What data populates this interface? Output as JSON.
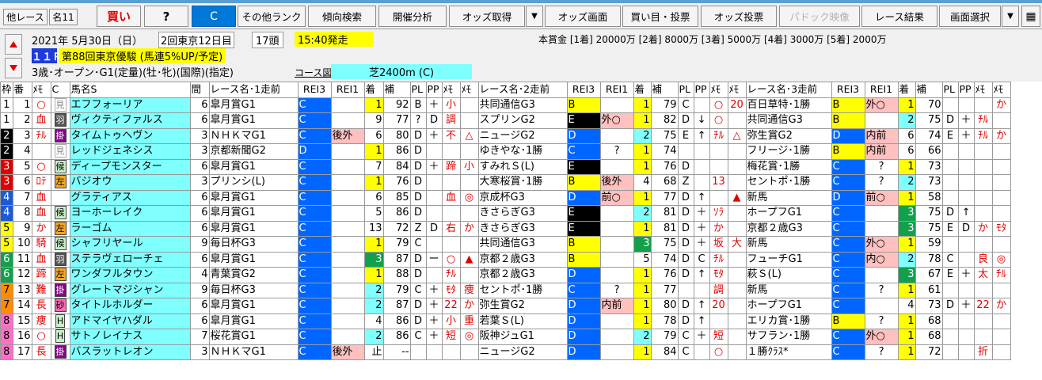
{
  "toolbar": {
    "other_race": "他レース",
    "meisho": "名11",
    "buy": "買い",
    "question": "?",
    "c": "C",
    "other_rank": "その他ランク",
    "trend_search": "傾向検索",
    "venue_analysis": "開催分析",
    "odds_get": "オッズ取得",
    "odds_screen": "オッズ画面",
    "buy_vote": "買い目・投票",
    "odds_vote": "オッズ投票",
    "paddock": "パドック映像",
    "race_result": "レース結果",
    "screen_select": "画面選択"
  },
  "race": {
    "date": "2021年 5月30日（日）",
    "meeting": "2回東京12日目",
    "heads": "17頭",
    "start": "15:40発走",
    "prize": "本賞金 [1着] 20000万 [2着] 8000万 [3着] 5000万 [4着] 3000万 [5着] 2000万",
    "number": "１１Ｒ",
    "name": "第88回東京優駿 (馬連5%UP/予定)",
    "conditions": "3歳･オープン･G1(定量)(牡･牝)(国際)(指定)",
    "course_label": "コース図",
    "course": "芝2400m (C)"
  },
  "headers": {
    "waku": "枠",
    "ban": "番",
    "mo": "ﾒﾓ",
    "c": "C",
    "name": "馬名S",
    "interval": "間",
    "race1": "レース名･1走前",
    "race2": "レース名･2走前",
    "race3": "レース名･3走前",
    "red3": "REI3",
    "red1": "REI1",
    "chaku": "着",
    "ho": "補",
    "pl": "PL",
    "pp": "PP",
    "me": "ﾒﾓ",
    "mo2": "ﾒﾓ"
  },
  "rows": [
    {
      "waku": "1",
      "ban": "1",
      "mo": "○",
      "mk": "見",
      "mkc": "ken",
      "name": "エフフォーリア",
      "int": "6",
      "r1": "皐月賞G1",
      "r1a": "C",
      "r1b": "",
      "r1c": "1",
      "r1h": "92",
      "r1pl": "B",
      "r1pp": "＋",
      "r1m1": "小",
      "r1m2": "",
      "r2": "共同通信G3",
      "r2a": "B",
      "r2b": "",
      "r2c": "1",
      "r2h": "79",
      "r2pl": "C",
      "r2pp": "",
      "r2m1": "○",
      "r2m2": "20",
      "r3": "百日草特･1勝",
      "r3a": "B",
      "r3b": "外○",
      "r3c": "1",
      "r3h": "70",
      "r3pl": "",
      "r3pp": "",
      "r3m1": "",
      "r3m2": "か"
    },
    {
      "waku": "1",
      "ban": "2",
      "mo": "血",
      "mk": "羽",
      "mkc": "ma",
      "name": "ヴィクティファルス",
      "int": "6",
      "r1": "皐月賞G1",
      "r1a": "C",
      "r1b": "",
      "r1c": "9",
      "r1h": "77",
      "r1pl": "?",
      "r1pp": "D",
      "r1m1": "調",
      "r1m2": "",
      "r2": "スプリンG2",
      "r2a": "E",
      "r2b": "外○",
      "r2c": "1",
      "r2h": "82",
      "r2pl": "D",
      "r2pp": "↓",
      "r2m1": "○",
      "r2m2": "",
      "r3": "共同通信G3",
      "r3a": "B",
      "r3b": "",
      "r3c": "2",
      "r3h": "75",
      "r3pl": "D",
      "r3pp": "＋",
      "r3m1": "ﾁﾙ",
      "r3m2": ""
    },
    {
      "waku": "2",
      "ban": "3",
      "mo": "ﾁﾙ",
      "mk": "掛",
      "mkc": "kake",
      "name": "タイムトゥヘヴン",
      "int": "3",
      "r1": "ＮＨＫマG1",
      "r1a": "C",
      "r1b": "後外",
      "r1c": "6",
      "r1h": "80",
      "r1pl": "D",
      "r1pp": "＋",
      "r1m1": "不",
      "r1m2": "△",
      "r2": "ニュージG2",
      "r2a": "D",
      "r2b": "",
      "r2c": "2",
      "r2h": "75",
      "r2pl": "E",
      "r2pp": "↑",
      "r2m1": "ﾁﾙ",
      "r2m2": "△",
      "r3": "弥生賞G2",
      "r3a": "D",
      "r3b": "内前",
      "r3c": "6",
      "r3h": "74",
      "r3pl": "E",
      "r3pp": "＋",
      "r3m1": "ﾁﾙ",
      "r3m2": "か"
    },
    {
      "waku": "2",
      "ban": "4",
      "mo": "",
      "mk": "見",
      "mkc": "ken",
      "name": "レッドジェネシス",
      "int": "3",
      "r1": "京都新聞G2",
      "r1a": "D",
      "r1b": "",
      "r1c": "1",
      "r1h": "86",
      "r1pl": "D",
      "r1pp": "",
      "r1m1": "",
      "r1m2": "",
      "r2": "ゆきやな･1勝",
      "r2a": "C",
      "r2b": "?",
      "r2c": "1",
      "r2h": "74",
      "r2pl": "",
      "r2pp": "",
      "r2m1": "",
      "r2m2": "",
      "r3": "フリージ･1勝",
      "r3a": "B",
      "r3b": "内前",
      "r3c": "6",
      "r3h": "66",
      "r3pl": "",
      "r3pp": "",
      "r3m1": "",
      "r3m2": ""
    },
    {
      "waku": "3",
      "ban": "5",
      "mo": "○",
      "mk": "候",
      "mkc": "ko",
      "name": "ディープモンスター",
      "int": "6",
      "r1": "皐月賞G1",
      "r1a": "C",
      "r1b": "",
      "r1c": "7",
      "r1h": "84",
      "r1pl": "D",
      "r1pp": "＋",
      "r1m1": "蹄",
      "r1m2": "小",
      "r2": "すみれＳ(L)",
      "r2a": "E",
      "r2b": "",
      "r2c": "1",
      "r2h": "76",
      "r2pl": "D",
      "r2pp": "",
      "r2m1": "",
      "r2m2": "",
      "r3": "梅花賞･1勝",
      "r3a": "C",
      "r3b": "?",
      "r3c": "1",
      "r3h": "73",
      "r3pl": "",
      "r3pp": "",
      "r3m1": "",
      "r3m2": ""
    },
    {
      "waku": "3",
      "ban": "6",
      "mo": "ﾛﾃ",
      "mk": "左",
      "mkc": "sen",
      "name": "バジオウ",
      "int": "3",
      "r1": "プリンシ(L)",
      "r1a": "C",
      "r1b": "",
      "r1c": "1",
      "r1h": "76",
      "r1pl": "D",
      "r1pp": "",
      "r1m1": "",
      "r1m2": "",
      "r2": "大寒桜賞･1勝",
      "r2a": "B",
      "r2b": "後外",
      "r2c": "4",
      "r2h": "68",
      "r2pl": "Z",
      "r2pp": "",
      "r2m1": "13",
      "r2m2": "",
      "r3": "セントポ･1勝",
      "r3a": "C",
      "r3b": "?",
      "r3c": "2",
      "r3h": "73",
      "r3pl": "",
      "r3pp": "",
      "r3m1": "",
      "r3m2": ""
    },
    {
      "waku": "4",
      "ban": "7",
      "mo": "血",
      "mk": "",
      "mkc": "",
      "name": "グラティアス",
      "int": "6",
      "r1": "皐月賞G1",
      "r1a": "C",
      "r1b": "",
      "r1c": "6",
      "r1h": "85",
      "r1pl": "D",
      "r1pp": "",
      "r1m1": "血",
      "r1m2": "◎",
      "r2": "京成杯G3",
      "r2a": "D",
      "r2b": "前○",
      "r2c": "1",
      "r2h": "77",
      "r2pl": "D",
      "r2pp": "↑",
      "r2m1": "",
      "r2m2": "▲",
      "r3": "新馬",
      "r3a": "D",
      "r3b": "前○",
      "r3c": "1",
      "r3h": "58",
      "r3pl": "",
      "r3pp": "",
      "r3m1": "",
      "r3m2": ""
    },
    {
      "waku": "4",
      "ban": "8",
      "mo": "血",
      "mk": "候",
      "mkc": "ko",
      "name": "ヨーホーレイク",
      "int": "6",
      "r1": "皐月賞G1",
      "r1a": "C",
      "r1b": "",
      "r1c": "5",
      "r1h": "86",
      "r1pl": "D",
      "r1pp": "",
      "r1m1": "",
      "r1m2": "",
      "r2": "きさらぎG3",
      "r2a": "E",
      "r2b": "",
      "r2c": "2",
      "r2h": "81",
      "r2pl": "D",
      "r2pp": "＋",
      "r2m1": "ｿﾗ",
      "r2m2": "",
      "r3": "ホープフG1",
      "r3a": "C",
      "r3b": "",
      "r3c": "3",
      "r3h": "75",
      "r3pl": "D",
      "r3pp": "↑",
      "r3m1": "",
      "r3m2": ""
    },
    {
      "waku": "5",
      "ban": "9",
      "mo": "か",
      "mk": "左",
      "mkc": "sen",
      "name": "ラーゴム",
      "int": "6",
      "r1": "皐月賞G1",
      "r1a": "C",
      "r1b": "",
      "r1c": "13",
      "r1h": "72",
      "r1pl": "Z",
      "r1pp": "D",
      "r1m1": "右",
      "r1m2": "か",
      "r2": "きさらぎG3",
      "r2a": "E",
      "r2b": "",
      "r2c": "1",
      "r2h": "81",
      "r2pl": "D",
      "r2pp": "＋",
      "r2m1": "か",
      "r2m2": "",
      "r3": "京都２歳G3",
      "r3a": "C",
      "r3b": "",
      "r3c": "3",
      "r3h": "75",
      "r3pl": "E",
      "r3pp": "D",
      "r3m1": "か",
      "r3m2": "ﾓﾀ"
    },
    {
      "waku": "5",
      "ban": "10",
      "mo": "騎",
      "mk": "候",
      "mkc": "ko",
      "name": "シャフリヤール",
      "int": "9",
      "r1": "毎日杯G3",
      "r1a": "C",
      "r1b": "",
      "r1c": "1",
      "r1h": "79",
      "r1pl": "C",
      "r1pp": "",
      "r1m1": "",
      "r1m2": "",
      "r2": "共同通信G3",
      "r2a": "B",
      "r2b": "",
      "r2c": "3",
      "r2h": "75",
      "r2pl": "D",
      "r2pp": "＋",
      "r2m1": "坂",
      "r2m2": "大",
      "r3": "新馬",
      "r3a": "C",
      "r3b": "外○",
      "r3c": "1",
      "r3h": "59",
      "r3pl": "",
      "r3pp": "",
      "r3m1": "",
      "r3m2": ""
    },
    {
      "waku": "6",
      "ban": "11",
      "mo": "血",
      "mk": "羽",
      "mkc": "ma",
      "name": "ステラヴェローチェ",
      "int": "6",
      "r1": "皐月賞G1",
      "r1a": "C",
      "r1b": "",
      "r1c": "3",
      "r1h": "87",
      "r1pl": "D",
      "r1pp": "ー",
      "r1m1": "○",
      "r1m2": "▲",
      "r2": "京都２歳G3",
      "r2a": "B",
      "r2b": "",
      "r2c": "5",
      "r2h": "74",
      "r2pl": "D",
      "r2pp": "C",
      "r2m1": "ﾁﾙ",
      "r2m2": "",
      "r3": "フューチG1",
      "r3a": "C",
      "r3b": "内○",
      "r3c": "2",
      "r3h": "78",
      "r3pl": "C",
      "r3pp": "",
      "r3m1": "良",
      "r3m2": "◎"
    },
    {
      "waku": "6",
      "ban": "12",
      "mo": "蹄",
      "mk": "左",
      "mkc": "sen",
      "name": "ワンダフルタウン",
      "int": "4",
      "r1": "青葉賞G2",
      "r1a": "C",
      "r1b": "",
      "r1c": "1",
      "r1h": "88",
      "r1pl": "D",
      "r1pp": "",
      "r1m1": "ﾁﾙ",
      "r1m2": "",
      "r2": "京都２歳G3",
      "r2a": "D",
      "r2b": "",
      "r2c": "1",
      "r2h": "76",
      "r2pl": "D",
      "r2pp": "↑",
      "r2m1": "ﾓﾀ",
      "r2m2": "",
      "r3": "萩Ｓ(L)",
      "r3a": "C",
      "r3b": "",
      "r3c": "3",
      "r3h": "67",
      "r3pl": "E",
      "r3pp": "＋",
      "r3m1": "太",
      "r3m2": "ﾁﾙ"
    },
    {
      "waku": "7",
      "ban": "13",
      "mo": "難",
      "mk": "掛",
      "mkc": "kake",
      "name": "グレートマジシャン",
      "int": "9",
      "r1": "毎日杯G3",
      "r1a": "C",
      "r1b": "",
      "r1c": "2",
      "r1h": "79",
      "r1pl": "C",
      "r1pp": "＋",
      "r1m1": "ﾓﾀ",
      "r1m2": "痩",
      "r2": "セントポ･1勝",
      "r2a": "C",
      "r2b": "?",
      "r2c": "1",
      "r2h": "77",
      "r2pl": "",
      "r2pp": "",
      "r2m1": "調",
      "r2m2": "",
      "r3": "新馬",
      "r3a": "C",
      "r3b": "?",
      "r3c": "1",
      "r3h": "61",
      "r3pl": "",
      "r3pp": "",
      "r3m1": "",
      "r3m2": ""
    },
    {
      "waku": "7",
      "ban": "14",
      "mo": "長",
      "mk": "砂",
      "mkc": "sa",
      "name": "タイトルホルダー",
      "int": "6",
      "r1": "皐月賞G1",
      "r1a": "C",
      "r1b": "",
      "r1c": "2",
      "r1h": "87",
      "r1pl": "D",
      "r1pp": "＋",
      "r1m1": "22",
      "r1m2": "か",
      "r2": "弥生賞G2",
      "r2a": "D",
      "r2b": "内前",
      "r2c": "1",
      "r2h": "80",
      "r2pl": "D",
      "r2pp": "↑",
      "r2m1": "20",
      "r2m2": "",
      "r3": "ホープフG1",
      "r3a": "C",
      "r3b": "",
      "r3c": "4",
      "r3h": "73",
      "r3pl": "D",
      "r3pp": "＋",
      "r3m1": "22",
      "r3m2": "か"
    },
    {
      "waku": "8",
      "ban": "15",
      "mo": "痩",
      "mk": "H",
      "mkc": "h",
      "name": "アドマイヤハダル",
      "int": "6",
      "r1": "皐月賞G1",
      "r1a": "C",
      "r1b": "",
      "r1c": "4",
      "r1h": "86",
      "r1pl": "D",
      "r1pp": "＋",
      "r1m1": "小",
      "r1m2": "重",
      "r2": "若葉Ｓ(L)",
      "r2a": "D",
      "r2b": "",
      "r2c": "1",
      "r2h": "78",
      "r2pl": "D",
      "r2pp": "↑",
      "r2m1": "",
      "r2m2": "",
      "r3": "エリカ賞･1勝",
      "r3a": "B",
      "r3b": "?",
      "r3c": "1",
      "r3h": "68",
      "r3pl": "",
      "r3pp": "",
      "r3m1": "",
      "r3m2": ""
    },
    {
      "waku": "8",
      "ban": "16",
      "mo": "○",
      "mk": "H",
      "mkc": "h",
      "name": "サトノレイナス",
      "int": "7",
      "r1": "桜花賞G1",
      "r1a": "C",
      "r1b": "",
      "r1c": "2",
      "r1h": "86",
      "r1pl": "C",
      "r1pp": "＋",
      "r1m1": "短",
      "r1m2": "◎",
      "r2": "阪神ジュG1",
      "r2a": "D",
      "r2b": "",
      "r2c": "2",
      "r2h": "79",
      "r2pl": "C",
      "r2pp": "＋",
      "r2m1": "短",
      "r2m2": "",
      "r3": "サフラン･1勝",
      "r3a": "C",
      "r3b": "外○",
      "r3c": "1",
      "r3h": "68",
      "r3pl": "",
      "r3pp": "",
      "r3m1": "",
      "r3m2": ""
    },
    {
      "waku": "8",
      "ban": "17",
      "mo": "長",
      "mk": "掛",
      "mkc": "kake",
      "name": "バスラットレオン",
      "int": "3",
      "r1": "ＮＨＫマG1",
      "r1a": "C",
      "r1b": "後外",
      "r1c": "止",
      "r1h": "--",
      "r1pl": "",
      "r1pp": "",
      "r1m1": "",
      "r1m2": "",
      "r2": "ニュージG2",
      "r2a": "D",
      "r2b": "",
      "r2c": "1",
      "r2h": "84",
      "r2pl": "C",
      "r2pp": "",
      "r2m1": "○",
      "r2m2": "",
      "r3": "１勝ｸﾗｽ*",
      "r3a": "C",
      "r3b": "?",
      "r3c": "1",
      "r3h": "72",
      "r3pl": "",
      "r3pp": "",
      "r3m1": "折",
      "r3m2": ""
    }
  ]
}
